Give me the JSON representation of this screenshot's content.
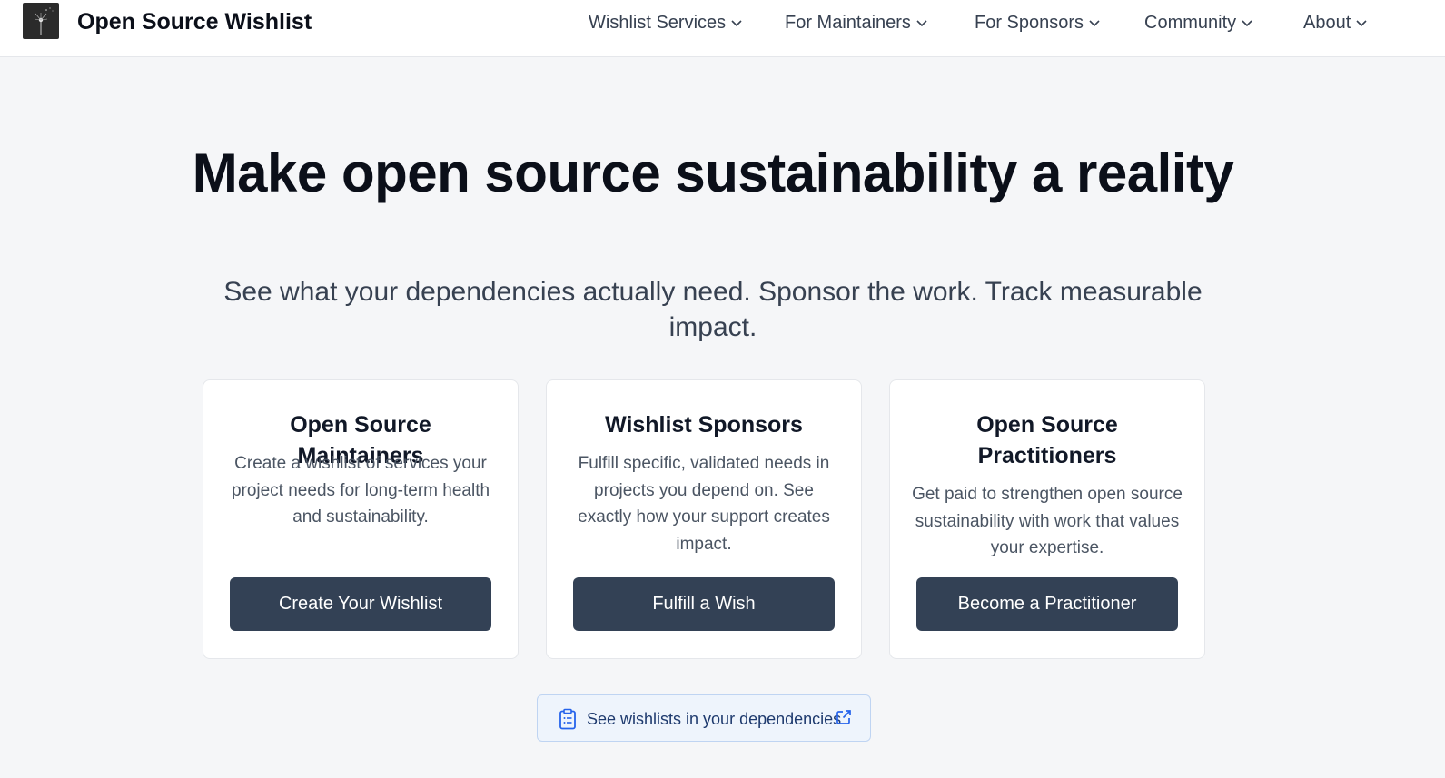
{
  "header": {
    "brand": "Open Source Wishlist",
    "logo_icon": "dandelion-icon",
    "nav": [
      {
        "label": "Wishlist Services"
      },
      {
        "label": "For Maintainers"
      },
      {
        "label": "For Sponsors"
      },
      {
        "label": "Community"
      },
      {
        "label": "About"
      }
    ]
  },
  "hero": {
    "title": "Make open source sustainability a reality",
    "subtitle": "See what your dependencies actually need. Sponsor the work. Track measurable impact."
  },
  "cards": [
    {
      "title": "Open Source Maintainers",
      "description": "Create a wishlist of services your project needs for long-term health and sustainability.",
      "button": "Create Your Wishlist"
    },
    {
      "title": "Wishlist Sponsors",
      "description": "Fulfill specific, validated needs in projects you depend on. See exactly how your support creates impact.",
      "button": "Fulfill a Wish"
    },
    {
      "title": "Open Source Practitioners",
      "description": "Get paid to strengthen open source sustainability with work that values your expertise.",
      "button": "Become a Practitioner"
    }
  ],
  "dependencies_link": {
    "label": "See wishlists in your dependencies",
    "icon": "clipboard-list-icon",
    "trailing_icon": "external-link-icon"
  },
  "colors": {
    "page_background": "#f5f6f8",
    "button_background": "#334155",
    "link_background": "#eef4fc",
    "link_text": "#1e3a6e"
  }
}
